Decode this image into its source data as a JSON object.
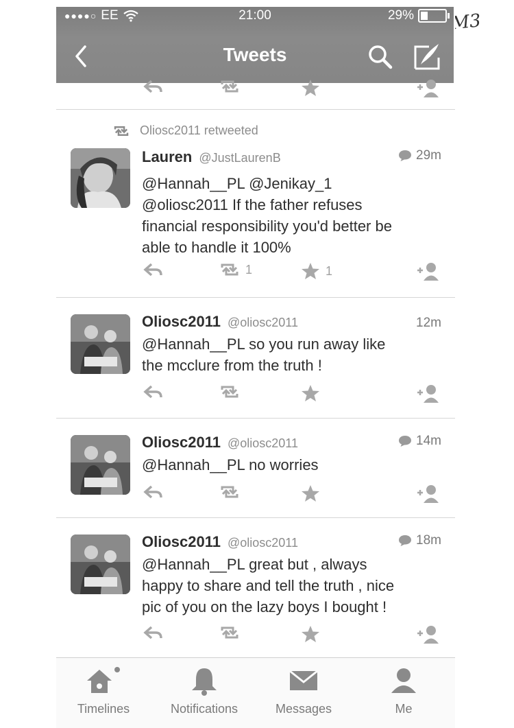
{
  "status_bar": {
    "carrier": "EE",
    "time": "21:00",
    "battery": "29%",
    "battery_level": 0.29
  },
  "header": {
    "title": "Tweets"
  },
  "annotation": "JM3",
  "tweets": [
    {
      "retweeted_by": "Oliosc2011 retweeted",
      "name": "Lauren",
      "handle": "@JustLaurenB",
      "time": "29m",
      "has_reply_icon": true,
      "text_lines": [
        "@Hannah__PL @Jenikay_1",
        "@oliosc2011 If the father refuses",
        "financial responsibility you'd better be",
        "able to handle it 100%"
      ],
      "retweet_count": "1",
      "favorite_count": "1"
    },
    {
      "name": "Oliosc2011",
      "handle": "@oliosc2011",
      "time": "12m",
      "has_reply_icon": false,
      "text_lines": [
        "@Hannah__PL so you run away like",
        "the mcclure from the truth !"
      ]
    },
    {
      "name": "Oliosc2011",
      "handle": "@oliosc2011",
      "time": "14m",
      "has_reply_icon": true,
      "text_lines": [
        "@Hannah__PL no worries"
      ]
    },
    {
      "name": "Oliosc2011",
      "handle": "@oliosc2011",
      "time": "18m",
      "has_reply_icon": true,
      "text_lines": [
        "@Hannah__PL great but , always",
        "happy to share and tell the truth , nice",
        "pic of you on the lazy boys I bought !"
      ]
    }
  ],
  "tabs": [
    {
      "label": "Timelines",
      "icon": "home-icon"
    },
    {
      "label": "Notifications",
      "icon": "bell-icon"
    },
    {
      "label": "Messages",
      "icon": "envelope-icon"
    },
    {
      "label": "Me",
      "icon": "person-icon"
    }
  ]
}
